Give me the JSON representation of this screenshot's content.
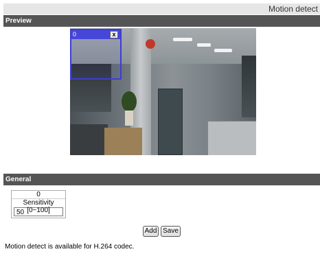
{
  "header": {
    "title": "Motion detect"
  },
  "preview": {
    "section_label": "Preview",
    "motion_window": {
      "id": "0",
      "close_symbol": "x"
    }
  },
  "general": {
    "section_label": "General",
    "window_table": {
      "window_id": "0",
      "sensitivity_label": "Sensitivity [0~100]",
      "sensitivity_value": "50"
    },
    "buttons": {
      "add_label": "Add",
      "save_label": "Save"
    },
    "note": "Motion detect is available for H.264 codec."
  },
  "colors": {
    "section_bar": "#555555",
    "motion_window_border": "#3d3dd6",
    "title_bar": "#e6e6e6"
  }
}
